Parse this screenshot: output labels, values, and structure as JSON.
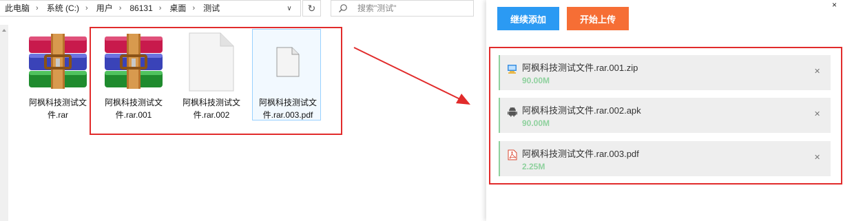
{
  "explorer": {
    "breadcrumb": [
      "此电脑",
      "系统 (C:)",
      "用户",
      "86131",
      "桌面",
      "测试"
    ],
    "search_placeholder": "搜索\"测试\"",
    "files": [
      {
        "name": "阿枫科技测试文件.rar",
        "line1": "阿枫科技测试文",
        "line2": "件.rar",
        "icon": "winrar-archive-icon"
      },
      {
        "name": "阿枫科技测试文件.rar.001",
        "line1": "阿枫科技测试文",
        "line2": "件.rar.001",
        "icon": "winrar-archive-icon"
      },
      {
        "name": "阿枫科技测试文件.rar.002",
        "line1": "阿枫科技测试文",
        "line2": "件.rar.002",
        "icon": "blank-document-icon"
      },
      {
        "name": "阿枫科技测试文件.rar.003.pdf",
        "line1": "阿枫科技测试文",
        "line2": "件.rar.003.pdf",
        "icon": "blank-document-icon"
      }
    ]
  },
  "uploader": {
    "add_label": "继续添加",
    "upload_label": "开始上传",
    "items": [
      {
        "name": "阿枫科技测试文件.rar.001.zip",
        "size": "90.00M",
        "icon": "zip-file-icon"
      },
      {
        "name": "阿枫科技测试文件.rar.002.apk",
        "size": "90.00M",
        "icon": "android-icon"
      },
      {
        "name": "阿枫科技测试文件.rar.003.pdf",
        "size": "2.25M",
        "icon": "pdf-file-icon"
      }
    ]
  },
  "colors": {
    "add_button": "#2b9af3",
    "upload_button": "#f66e35",
    "highlight": "#e12b2b",
    "size_text": "#8fd19e"
  }
}
